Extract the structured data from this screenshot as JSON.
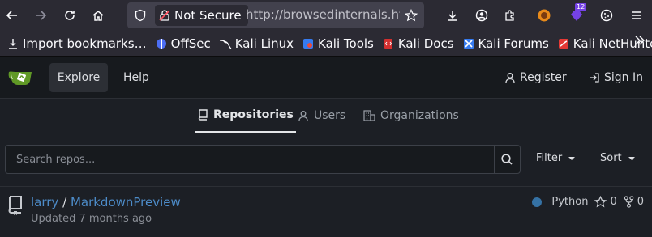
{
  "browser": {
    "security_label": "Not Secure",
    "url": "http://browsedinternals.htb",
    "extension_badge": "12"
  },
  "bookmarks": [
    {
      "label": "Import bookmarks…",
      "icon": "import-icon"
    },
    {
      "label": "OffSec",
      "icon": "offsec-icon"
    },
    {
      "label": "Kali Linux",
      "icon": "kali-dragon-icon"
    },
    {
      "label": "Kali Tools",
      "icon": "kali-tools-icon"
    },
    {
      "label": "Kali Docs",
      "icon": "kali-docs-icon"
    },
    {
      "label": "Kali Forums",
      "icon": "kali-forums-icon"
    },
    {
      "label": "Kali NetHunter",
      "icon": "kali-nethunter-icon"
    }
  ],
  "gitea_nav": {
    "explore": "Explore",
    "help": "Help",
    "register": "Register",
    "sign_in": "Sign In"
  },
  "tabs": [
    {
      "label": "Repositories",
      "active": true
    },
    {
      "label": "Users",
      "active": false
    },
    {
      "label": "Organizations",
      "active": false
    }
  ],
  "search": {
    "placeholder": "Search repos...",
    "filter": "Filter",
    "sort": "Sort"
  },
  "repos": [
    {
      "owner": "larry",
      "separator": "/",
      "name": "MarkdownPreview",
      "updated": "Updated 7 months ago",
      "language": "Python",
      "language_color": "#3572a5",
      "stars": "0",
      "forks": "0"
    }
  ]
}
